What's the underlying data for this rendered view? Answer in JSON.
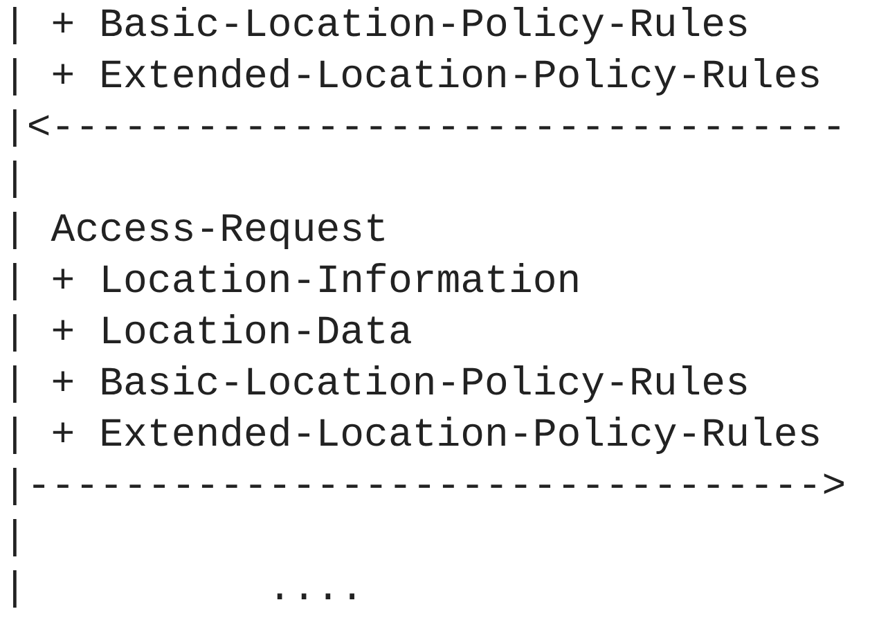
{
  "lines": [
    "| + Basic-Location-Policy-Rules",
    "| + Extended-Location-Policy-Rules",
    "|<---------------------------------",
    "|",
    "| Access-Request",
    "| + Location-Information",
    "| + Location-Data",
    "| + Basic-Location-Policy-Rules",
    "| + Extended-Location-Policy-Rules",
    "|--------------------------------->",
    "|",
    "|          ...."
  ]
}
